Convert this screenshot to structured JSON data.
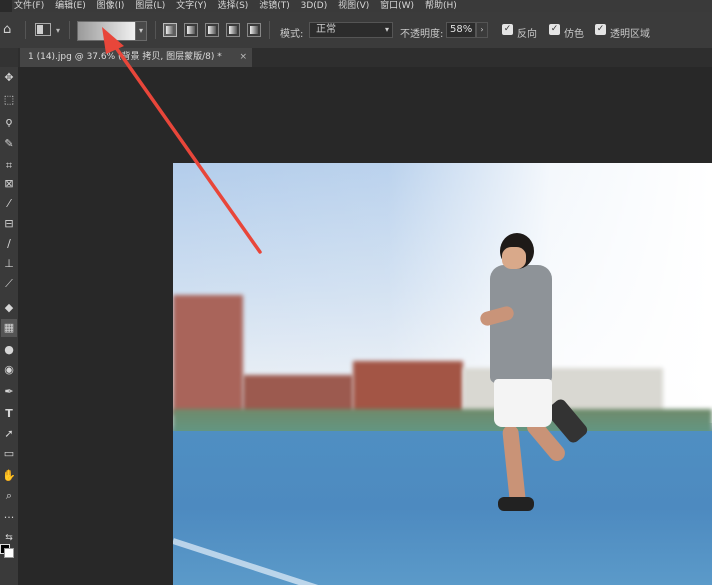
{
  "menubar": {
    "items": [
      "文件(F)",
      "编辑(E)",
      "图像(I)",
      "图层(L)",
      "文字(Y)",
      "选择(S)",
      "滤镜(T)",
      "3D(D)",
      "视图(V)",
      "窗口(W)",
      "帮助(H)"
    ]
  },
  "options": {
    "home_icon": "home-icon",
    "mode_label": "模式:",
    "mode_value": "正常",
    "opacity_label": "不透明度:",
    "opacity_value": "58%",
    "reverse_label": "反向",
    "dither_label": "仿色",
    "transparency_label": "透明区域",
    "gradient_colors": [
      "#9a9a9a",
      "#f2f2f2"
    ]
  },
  "document": {
    "tab_title": "1 (14).jpg @ 37.6% (背景 拷贝, 图层蒙版/8) *",
    "close_glyph": "×"
  },
  "tools": [
    "move-icon",
    "marquee-icon",
    "lasso-icon",
    "quick-select-icon",
    "crop-icon",
    "frame-icon",
    "eyedropper-icon",
    "healing-icon",
    "brush-icon",
    "stamp-icon",
    "history-brush-icon",
    "eraser-icon",
    "gradient-icon",
    "blur-icon",
    "dodge-icon",
    "pen-icon",
    "type-icon",
    "path-select-icon",
    "rectangle-icon",
    "hand-icon",
    "zoom-icon",
    "more-icon"
  ],
  "annotation": {
    "color": "#e8463a"
  }
}
